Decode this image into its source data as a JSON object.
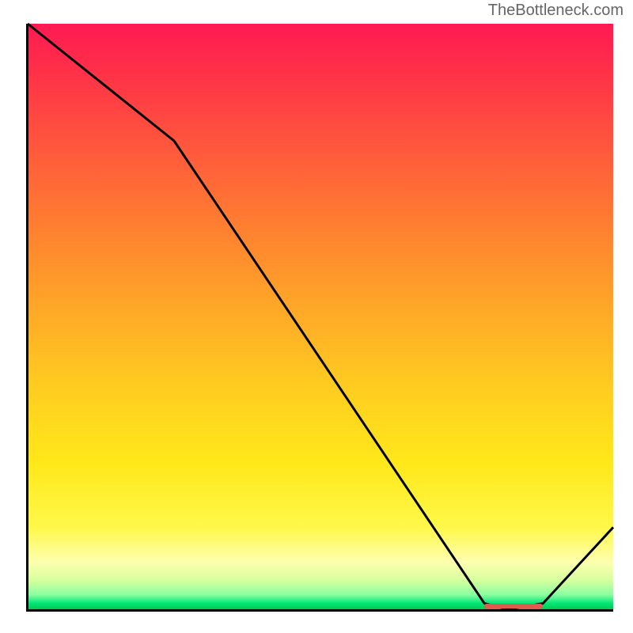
{
  "watermark": "TheBottleneck.com",
  "chart_data": {
    "type": "line",
    "title": "",
    "xlabel": "",
    "ylabel": "",
    "xlim": [
      0,
      100
    ],
    "ylim": [
      0,
      100
    ],
    "series": [
      {
        "name": "bottleneck-curve",
        "x": [
          0,
          25,
          78,
          82,
          88,
          100
        ],
        "values": [
          100,
          80,
          1,
          0,
          1,
          14
        ]
      }
    ],
    "optimal_range": {
      "x_start": 78,
      "x_end": 88,
      "y": 0.5
    },
    "gradient": {
      "top_color": "#ff1a52",
      "mid_color": "#ffe81a",
      "bottom_color": "#00c853"
    }
  }
}
